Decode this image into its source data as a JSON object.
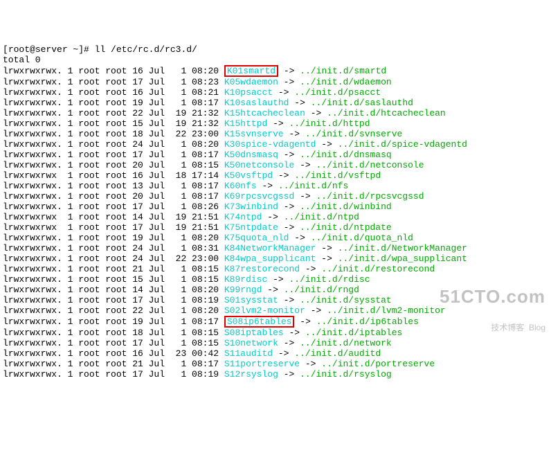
{
  "prompt": {
    "open": "[",
    "user_host": "root@server ~",
    "close": "]#",
    "command": " ll /etc/rc.d/rc3.d/"
  },
  "total_line": "total 0",
  "rows": [
    {
      "perm": "lrwxrwxrwx.",
      "n": "1",
      "u": "root",
      "g": "root",
      "sz": "16",
      "mon": "Jul",
      "day": "  1",
      "time": "08:20",
      "name": "K01smartd",
      "arrow": " -> ",
      "target": "../init.d/smartd",
      "hl": true
    },
    {
      "perm": "lrwxrwxrwx.",
      "n": "1",
      "u": "root",
      "g": "root",
      "sz": "17",
      "mon": "Jul",
      "day": "  1",
      "time": "08:23",
      "name": "K05wdaemon",
      "arrow": " -> ",
      "target": "../init.d/wdaemon"
    },
    {
      "perm": "lrwxrwxrwx.",
      "n": "1",
      "u": "root",
      "g": "root",
      "sz": "16",
      "mon": "Jul",
      "day": "  1",
      "time": "08:21",
      "name": "K10psacct",
      "arrow": " -> ",
      "target": "../init.d/psacct"
    },
    {
      "perm": "lrwxrwxrwx.",
      "n": "1",
      "u": "root",
      "g": "root",
      "sz": "19",
      "mon": "Jul",
      "day": "  1",
      "time": "08:17",
      "name": "K10saslauthd",
      "arrow": " -> ",
      "target": "../init.d/saslauthd"
    },
    {
      "perm": "lrwxrwxrwx.",
      "n": "1",
      "u": "root",
      "g": "root",
      "sz": "22",
      "mon": "Jul",
      "day": " 19",
      "time": "21:32",
      "name": "K15htcacheclean",
      "arrow": " -> ",
      "target": "../init.d/htcacheclean"
    },
    {
      "perm": "lrwxrwxrwx.",
      "n": "1",
      "u": "root",
      "g": "root",
      "sz": "15",
      "mon": "Jul",
      "day": " 19",
      "time": "21:32",
      "name": "K15httpd",
      "arrow": " -> ",
      "target": "../init.d/httpd"
    },
    {
      "perm": "lrwxrwxrwx.",
      "n": "1",
      "u": "root",
      "g": "root",
      "sz": "18",
      "mon": "Jul",
      "day": " 22",
      "time": "23:00",
      "name": "K15svnserve",
      "arrow": " -> ",
      "target": "../init.d/svnserve"
    },
    {
      "perm": "lrwxrwxrwx.",
      "n": "1",
      "u": "root",
      "g": "root",
      "sz": "24",
      "mon": "Jul",
      "day": "  1",
      "time": "08:20",
      "name": "K30spice-vdagentd",
      "arrow": " -> ",
      "target": "../init.d/spice-vdagentd"
    },
    {
      "perm": "lrwxrwxrwx.",
      "n": "1",
      "u": "root",
      "g": "root",
      "sz": "17",
      "mon": "Jul",
      "day": "  1",
      "time": "08:17",
      "name": "K50dnsmasq",
      "arrow": " -> ",
      "target": "../init.d/dnsmasq"
    },
    {
      "perm": "lrwxrwxrwx.",
      "n": "1",
      "u": "root",
      "g": "root",
      "sz": "20",
      "mon": "Jul",
      "day": "  1",
      "time": "08:15",
      "name": "K50netconsole",
      "arrow": " -> ",
      "target": "../init.d/netconsole"
    },
    {
      "perm": "lrwxrwxrwx",
      "n": "1",
      "u": "root",
      "g": "root",
      "sz": "16",
      "mon": "Jul",
      "day": " 18",
      "time": "17:14",
      "name": "K50vsftpd",
      "arrow": " -> ",
      "target": "../init.d/vsftpd"
    },
    {
      "perm": "lrwxrwxrwx.",
      "n": "1",
      "u": "root",
      "g": "root",
      "sz": "13",
      "mon": "Jul",
      "day": "  1",
      "time": "08:17",
      "name": "K60nfs",
      "arrow": " -> ",
      "target": "../init.d/nfs"
    },
    {
      "perm": "lrwxrwxrwx.",
      "n": "1",
      "u": "root",
      "g": "root",
      "sz": "20",
      "mon": "Jul",
      "day": "  1",
      "time": "08:17",
      "name": "K69rpcsvcgssd",
      "arrow": " -> ",
      "target": "../init.d/rpcsvcgssd"
    },
    {
      "perm": "lrwxrwxrwx.",
      "n": "1",
      "u": "root",
      "g": "root",
      "sz": "17",
      "mon": "Jul",
      "day": "  1",
      "time": "08:26",
      "name": "K73winbind",
      "arrow": " -> ",
      "target": "../init.d/winbind"
    },
    {
      "perm": "lrwxrwxrwx",
      "n": "1",
      "u": "root",
      "g": "root",
      "sz": "14",
      "mon": "Jul",
      "day": " 19",
      "time": "21:51",
      "name": "K74ntpd",
      "arrow": " -> ",
      "target": "../init.d/ntpd"
    },
    {
      "perm": "lrwxrwxrwx",
      "n": "1",
      "u": "root",
      "g": "root",
      "sz": "17",
      "mon": "Jul",
      "day": " 19",
      "time": "21:51",
      "name": "K75ntpdate",
      "arrow": " -> ",
      "target": "../init.d/ntpdate"
    },
    {
      "perm": "lrwxrwxrwx.",
      "n": "1",
      "u": "root",
      "g": "root",
      "sz": "19",
      "mon": "Jul",
      "day": "  1",
      "time": "08:20",
      "name": "K75quota_nld",
      "arrow": " -> ",
      "target": "../init.d/quota_nld"
    },
    {
      "perm": "lrwxrwxrwx.",
      "n": "1",
      "u": "root",
      "g": "root",
      "sz": "24",
      "mon": "Jul",
      "day": "  1",
      "time": "08:31",
      "name": "K84NetworkManager",
      "arrow": " -> ",
      "target": "../init.d/NetworkManager"
    },
    {
      "perm": "lrwxrwxrwx.",
      "n": "1",
      "u": "root",
      "g": "root",
      "sz": "24",
      "mon": "Jul",
      "day": " 22",
      "time": "23:00",
      "name": "K84wpa_supplicant",
      "arrow": " -> ",
      "target": "../init.d/wpa_supplicant"
    },
    {
      "perm": "lrwxrwxrwx.",
      "n": "1",
      "u": "root",
      "g": "root",
      "sz": "21",
      "mon": "Jul",
      "day": "  1",
      "time": "08:15",
      "name": "K87restorecond",
      "arrow": " -> ",
      "target": "../init.d/restorecond"
    },
    {
      "perm": "lrwxrwxrwx.",
      "n": "1",
      "u": "root",
      "g": "root",
      "sz": "15",
      "mon": "Jul",
      "day": "  1",
      "time": "08:15",
      "name": "K89rdisc",
      "arrow": " -> ",
      "target": "../init.d/rdisc"
    },
    {
      "perm": "lrwxrwxrwx.",
      "n": "1",
      "u": "root",
      "g": "root",
      "sz": "14",
      "mon": "Jul",
      "day": "  1",
      "time": "08:20",
      "name": "K99rngd",
      "arrow": " -> ",
      "target": "../init.d/rngd"
    },
    {
      "perm": "lrwxrwxrwx.",
      "n": "1",
      "u": "root",
      "g": "root",
      "sz": "17",
      "mon": "Jul",
      "day": "  1",
      "time": "08:19",
      "name": "S01sysstat",
      "arrow": " -> ",
      "target": "../init.d/sysstat"
    },
    {
      "perm": "lrwxrwxrwx.",
      "n": "1",
      "u": "root",
      "g": "root",
      "sz": "22",
      "mon": "Jul",
      "day": "  1",
      "time": "08:20",
      "name": "S02lvm2-monitor",
      "arrow": " -> ",
      "target": "../init.d/lvm2-monitor"
    },
    {
      "perm": "lrwxrwxrwx.",
      "n": "1",
      "u": "root",
      "g": "root",
      "sz": "19",
      "mon": "Jul",
      "day": "  1",
      "time": "08:17",
      "name": "S08ip6tables",
      "arrow": " -> ",
      "target": "../init.d/ip6tables",
      "hl": true
    },
    {
      "perm": "lrwxrwxrwx.",
      "n": "1",
      "u": "root",
      "g": "root",
      "sz": "18",
      "mon": "Jul",
      "day": "  1",
      "time": "08:15",
      "name": "S08iptables",
      "arrow": " -> ",
      "target": "../init.d/iptables"
    },
    {
      "perm": "lrwxrwxrwx.",
      "n": "1",
      "u": "root",
      "g": "root",
      "sz": "17",
      "mon": "Jul",
      "day": "  1",
      "time": "08:15",
      "name": "S10network",
      "arrow": " -> ",
      "target": "../init.d/network"
    },
    {
      "perm": "lrwxrwxrwx.",
      "n": "1",
      "u": "root",
      "g": "root",
      "sz": "16",
      "mon": "Jul",
      "day": " 23",
      "time": "00:42",
      "name": "S11auditd",
      "arrow": " -> ",
      "target": "../init.d/auditd"
    },
    {
      "perm": "lrwxrwxrwx.",
      "n": "1",
      "u": "root",
      "g": "root",
      "sz": "21",
      "mon": "Jul",
      "day": "  1",
      "time": "08:17",
      "name": "S11portreserve",
      "arrow": " -> ",
      "target": "../init.d/portreserve"
    },
    {
      "perm": "lrwxrwxrwx.",
      "n": "1",
      "u": "root",
      "g": "root",
      "sz": "17",
      "mon": "Jul",
      "day": "  1",
      "time": "08:19",
      "name": "S12rsyslog",
      "arrow": " -> ",
      "target": "../init.d/rsyslog"
    }
  ],
  "watermark": {
    "big": "51CTO.com",
    "small": "技术博客  Blog"
  }
}
